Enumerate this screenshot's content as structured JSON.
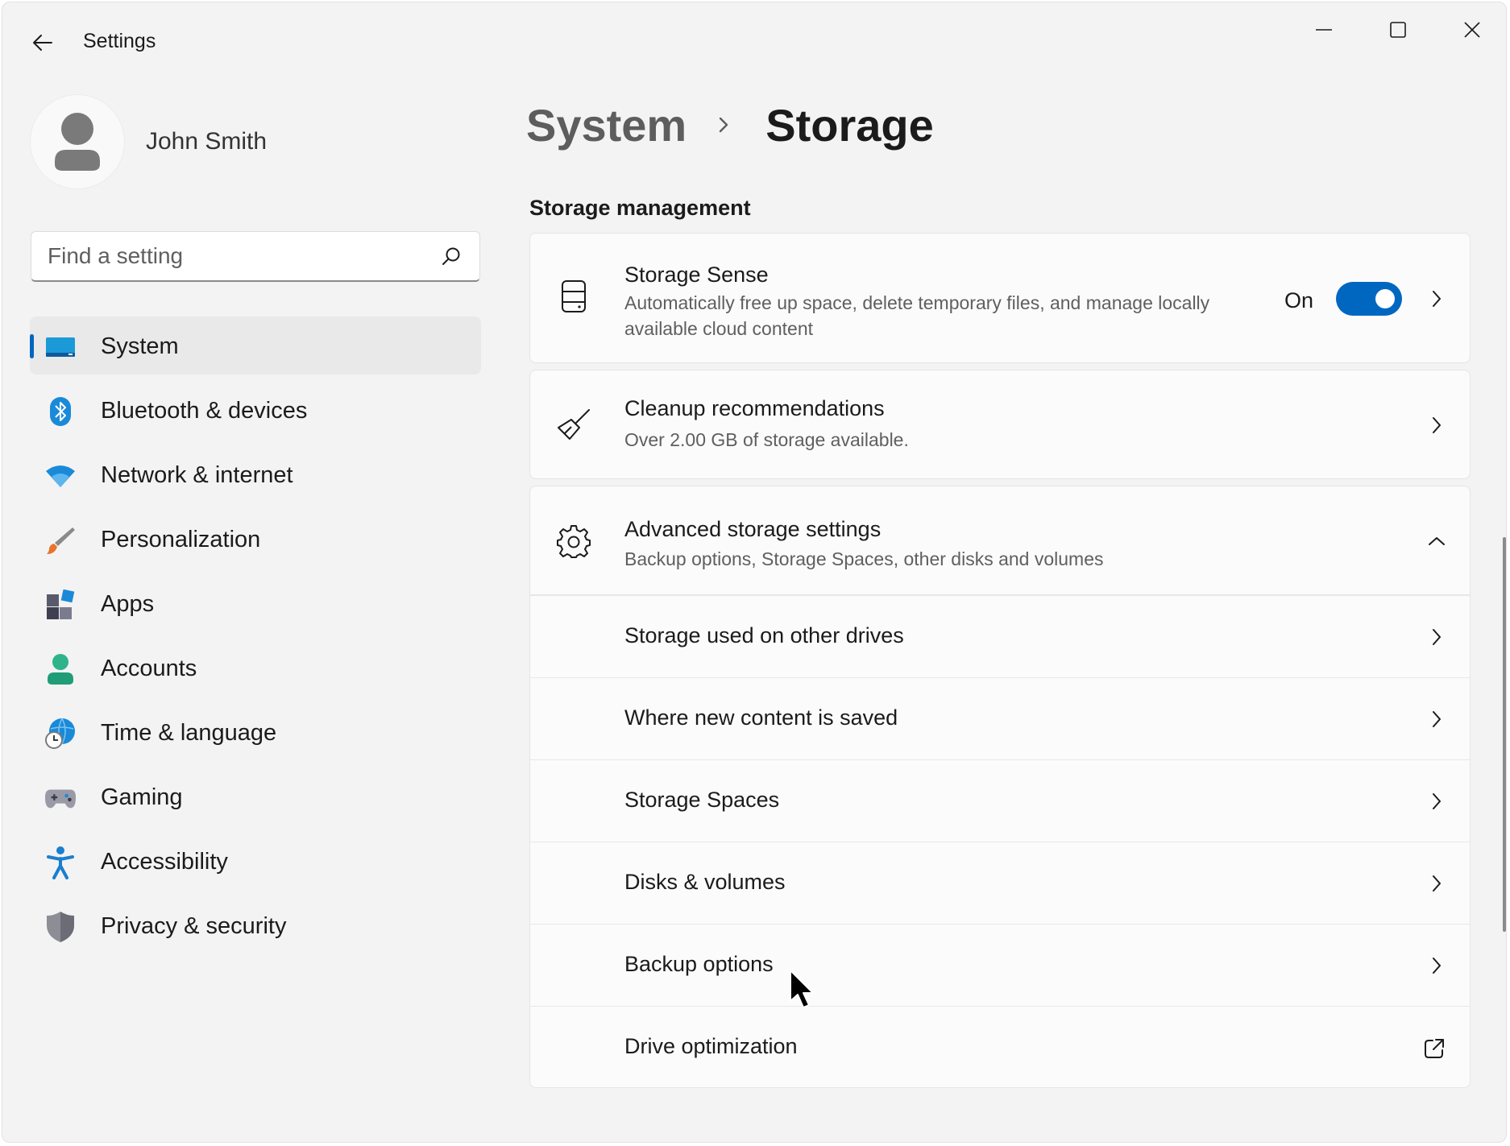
{
  "window": {
    "title": "Settings"
  },
  "profile": {
    "name": "John Smith"
  },
  "search": {
    "placeholder": "Find a setting",
    "value": ""
  },
  "sidebar": {
    "items": [
      {
        "label": "System",
        "icon": "system-icon",
        "selected": true
      },
      {
        "label": "Bluetooth & devices",
        "icon": "bluetooth-icon"
      },
      {
        "label": "Network & internet",
        "icon": "wifi-icon"
      },
      {
        "label": "Personalization",
        "icon": "paintbrush-icon"
      },
      {
        "label": "Apps",
        "icon": "apps-icon"
      },
      {
        "label": "Accounts",
        "icon": "person-icon"
      },
      {
        "label": "Time & language",
        "icon": "globe-clock-icon"
      },
      {
        "label": "Gaming",
        "icon": "gamepad-icon"
      },
      {
        "label": "Accessibility",
        "icon": "accessibility-icon"
      },
      {
        "label": "Privacy & security",
        "icon": "shield-icon"
      }
    ]
  },
  "breadcrumb": {
    "parent": "System",
    "current": "Storage"
  },
  "section": {
    "title": "Storage management"
  },
  "storage_sense": {
    "title": "Storage Sense",
    "description": "Automatically free up space, delete temporary files, and manage locally available cloud content",
    "toggle_label": "On",
    "toggle_on": true,
    "icon": "storage-drive-icon"
  },
  "cleanup": {
    "title": "Cleanup recommendations",
    "description": "Over 2.00 GB of storage available.",
    "icon": "broom-icon"
  },
  "advanced": {
    "title": "Advanced storage settings",
    "description": "Backup options, Storage Spaces, other disks and volumes",
    "expanded": true,
    "icon": "gear-icon",
    "items": [
      {
        "label": "Storage used on other drives",
        "action": "chevron-right-icon"
      },
      {
        "label": "Where new content is saved",
        "action": "chevron-right-icon"
      },
      {
        "label": "Storage Spaces",
        "action": "chevron-right-icon"
      },
      {
        "label": "Disks & volumes",
        "action": "chevron-right-icon"
      },
      {
        "label": "Backup options",
        "action": "chevron-right-icon"
      },
      {
        "label": "Drive optimization",
        "action": "external-link-icon"
      }
    ]
  },
  "colors": {
    "accent": "#0067c0",
    "window_bg": "#f3f3f3",
    "card_bg": "#fbfbfb"
  }
}
